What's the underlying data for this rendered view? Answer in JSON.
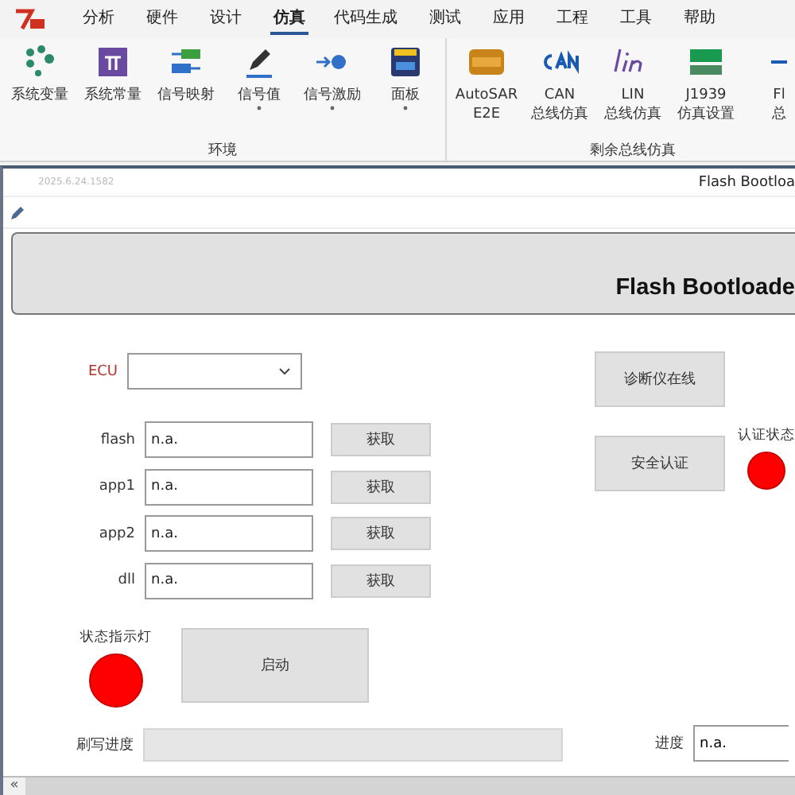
{
  "menu": [
    {
      "label": "分析",
      "selected": false
    },
    {
      "label": "硬件",
      "selected": false
    },
    {
      "label": "设计",
      "selected": false
    },
    {
      "label": "仿真",
      "selected": true
    },
    {
      "label": "代码生成",
      "selected": false
    },
    {
      "label": "测试",
      "selected": false
    },
    {
      "label": "应用",
      "selected": false
    },
    {
      "label": "工程",
      "selected": false
    },
    {
      "label": "工具",
      "selected": false
    },
    {
      "label": "帮助",
      "selected": false
    }
  ],
  "ribbon": [
    {
      "label": "环境",
      "items": [
        {
          "lines": [
            "系统变量"
          ],
          "dropdown": false
        },
        {
          "lines": [
            "系统常量"
          ],
          "dropdown": false
        },
        {
          "lines": [
            "信号映射"
          ],
          "dropdown": false
        },
        {
          "lines": [
            "信号值"
          ],
          "dropdown": true
        },
        {
          "lines": [
            "信号激励"
          ],
          "dropdown": true
        },
        {
          "lines": [
            "面板"
          ],
          "dropdown": true
        }
      ]
    },
    {
      "label": "剩余总线仿真",
      "items": [
        {
          "lines": [
            "AutoSAR",
            "E2E"
          ],
          "dropdown": false
        },
        {
          "lines": [
            "CAN",
            "总线仿真"
          ],
          "dropdown": false
        },
        {
          "lines": [
            "LIN",
            "总线仿真"
          ],
          "dropdown": false
        },
        {
          "lines": [
            "J1939",
            "仿真设置"
          ],
          "dropdown": false
        },
        {
          "lines": [
            "Fl",
            "总"
          ],
          "dropdown": false
        }
      ]
    }
  ],
  "panel": {
    "version": "2025.6.24.1582",
    "title": "Flash Bootloa",
    "header": "Flash Bootloade"
  },
  "form": {
    "ecu": {
      "label": "ECU"
    },
    "files": [
      {
        "label": "flash",
        "value": "n.a.",
        "button": "获取"
      },
      {
        "label": "app1",
        "value": "n.a.",
        "button": "获取"
      },
      {
        "label": "app2",
        "value": "n.a.",
        "button": "获取"
      },
      {
        "label": "dll",
        "value": "n.a.",
        "button": "获取"
      }
    ],
    "status_lamp": {
      "label": "状态指示灯",
      "color": "#ff0000"
    },
    "start_button": "启动",
    "progress": {
      "label": "刷写进度",
      "level": 0
    },
    "progress_value": {
      "label": "进度",
      "value": "n.a."
    }
  },
  "right": {
    "diag_button": "诊断仪在线",
    "auth_button": "安全认证",
    "auth_lamp": {
      "label": "认证状态",
      "color": "#ff0000"
    }
  },
  "scrollbar": {
    "arrow": "«"
  }
}
